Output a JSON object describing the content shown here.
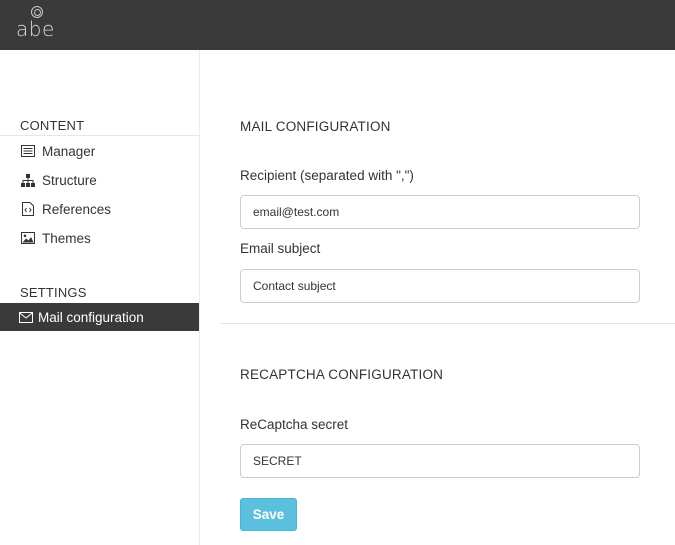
{
  "header": {
    "logo_text": "abe"
  },
  "sidebar": {
    "content_title": "CONTENT",
    "items": [
      {
        "label": "Manager",
        "icon": "list-icon"
      },
      {
        "label": "Structure",
        "icon": "sitemap-icon"
      },
      {
        "label": "References",
        "icon": "code-file-icon"
      },
      {
        "label": "Themes",
        "icon": "image-icon"
      }
    ],
    "settings_title": "SETTINGS",
    "settings_items": [
      {
        "label": "Mail configuration",
        "icon": "envelope-icon",
        "active": true
      }
    ]
  },
  "main": {
    "mail": {
      "title": "MAIL CONFIGURATION",
      "recipient_label": "Recipient (separated with \",\")",
      "recipient_value": "email@test.com",
      "subject_label": "Email subject",
      "subject_value": "Contact subject"
    },
    "recaptcha": {
      "title": "RECAPTCHA CONFIGURATION",
      "secret_label": "ReCaptcha secret",
      "secret_value": "SECRET"
    },
    "save_label": "Save"
  },
  "colors": {
    "topbar": "#3a3a3a",
    "active_nav": "#3a3a3a",
    "save_button": "#5bc0de"
  }
}
